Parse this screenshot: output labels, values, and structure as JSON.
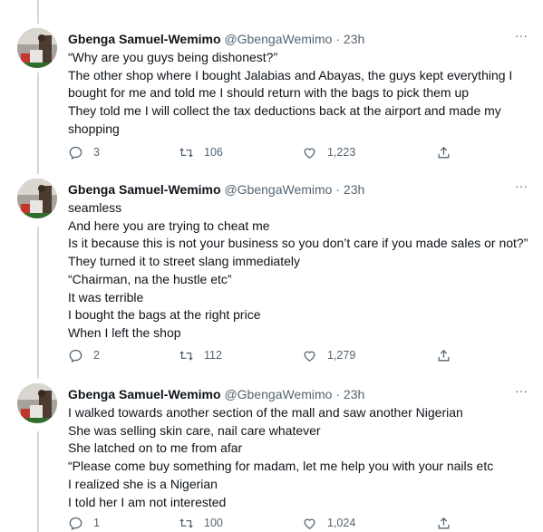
{
  "tweets": [
    {
      "author_name": "Gbenga Samuel-Wemimo",
      "handle": "@GbengaWemimo",
      "separator": "·",
      "time": "23h",
      "more": "···",
      "lines": [
        "“Why are you guys being dishonest?”",
        "The other shop where I bought Jalabias and Abayas, the guys kept everything I",
        "bought for me and told me I should return with the bags to pick them up",
        "They told me I will collect the tax deductions back at the airport and made my",
        "shopping"
      ],
      "replies": "3",
      "retweets": "106",
      "likes": "1,223"
    },
    {
      "author_name": "Gbenga Samuel-Wemimo",
      "handle": "@GbengaWemimo",
      "separator": "·",
      "time": "23h",
      "more": "···",
      "lines": [
        "seamless",
        "And here you are trying to cheat me",
        "Is it because this is not your business so you don’t care if you made sales or not?”",
        "They turned it to street slang immediately",
        "“Chairman, na the hustle etc”",
        "It was terrible",
        "I bought the bags at the right price",
        "When I left the shop"
      ],
      "replies": "2",
      "retweets": "112",
      "likes": "1,279"
    },
    {
      "author_name": "Gbenga Samuel-Wemimo",
      "handle": "@GbengaWemimo",
      "separator": "·",
      "time": "23h",
      "more": "···",
      "lines": [
        "I walked towards another section of the mall and saw another Nigerian",
        "She was selling skin care, nail care whatever",
        "She latched on to me from afar",
        "“Please come buy something for madam, let me help you with your nails etc",
        "I realized she is a Nigerian",
        "I told her I am not interested"
      ],
      "replies": "1",
      "retweets": "100",
      "likes": "1,024"
    }
  ],
  "colors": {
    "text": "#0f1419",
    "muted": "#536471",
    "thread_line": "#cfd9de"
  },
  "icons": [
    "reply-icon",
    "retweet-icon",
    "like-icon",
    "share-icon",
    "more-icon"
  ]
}
